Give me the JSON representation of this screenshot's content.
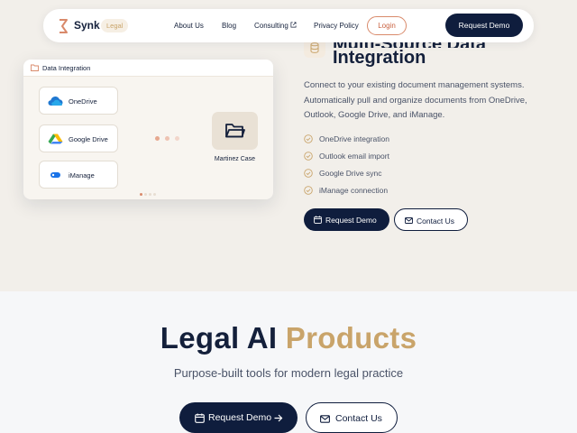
{
  "navbar": {
    "brand": "Synk",
    "badge": "Legal",
    "links": {
      "about": "About Us",
      "blog": "Blog",
      "consulting": "Consulting",
      "privacy": "Privacy Policy"
    },
    "login": "Login",
    "request_demo": "Request Demo"
  },
  "panel": {
    "title": "Data Integration",
    "sources": [
      "OneDrive",
      "Google Drive",
      "iManage"
    ],
    "destination": "Martinez Case"
  },
  "feature": {
    "title_line1": "Multi-Source Data",
    "title_line2": "Integration",
    "description": "Connect to your existing document management systems. Automatically pull and organize documents from OneDrive, Outlook, Google Drive, and iManage.",
    "bullets": [
      "OneDrive integration",
      "Outlook email import",
      "Google Drive sync",
      "iManage connection"
    ],
    "request_demo": "Request Demo",
    "contact_us": "Contact Us"
  },
  "hero": {
    "title_part1": "Legal AI",
    "title_part2": "Products",
    "subtitle": "Purpose-built tools for modern legal practice",
    "request_demo": "Request Demo",
    "contact_us": "Contact Us"
  },
  "colors": {
    "navy": "#0f1d3d",
    "gold": "#c9a46a",
    "coral": "#d98a6b",
    "cream": "#f2efea"
  }
}
